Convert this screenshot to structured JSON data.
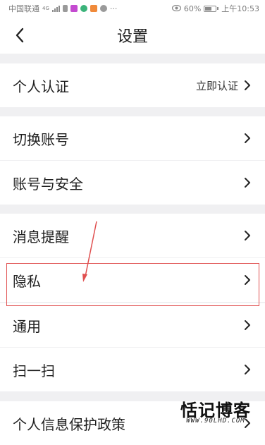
{
  "status_bar": {
    "carrier": "中国联通",
    "network": "4G",
    "battery": "60%",
    "time": "上午10:53",
    "battery_level": 0.6
  },
  "header": {
    "title": "设置",
    "back_icon": "back-chevron-icon"
  },
  "sections": {
    "identity": {
      "label": "个人认证",
      "value": "立即认证"
    },
    "account": [
      {
        "label": "切换账号"
      },
      {
        "label": "账号与安全"
      }
    ],
    "general": [
      {
        "label": "消息提醒"
      },
      {
        "label": "隐私"
      },
      {
        "label": "通用"
      },
      {
        "label": "扫一扫"
      }
    ],
    "policy": {
      "label": "个人信息保护政策"
    }
  },
  "watermark": {
    "title": "恬记博客",
    "subtitle": "WWW.90LHD.COM"
  },
  "colors": {
    "highlight_border": "#e05050",
    "separator": "#f0f0f2"
  }
}
